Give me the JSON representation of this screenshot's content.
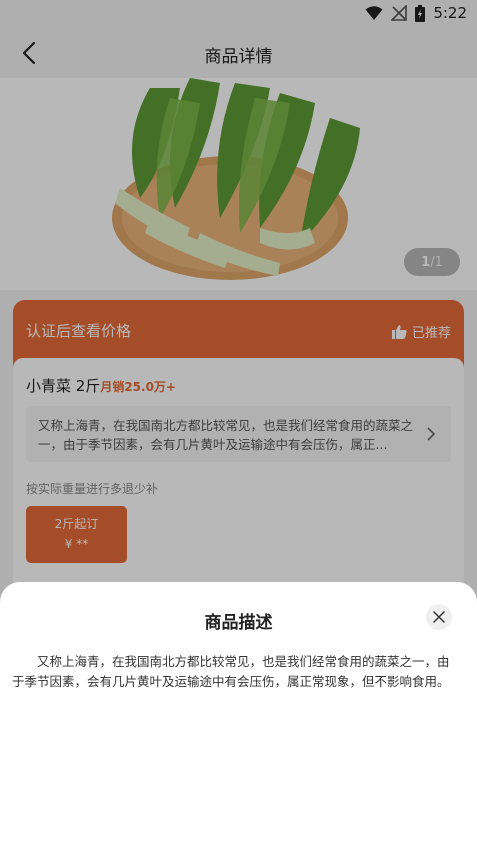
{
  "status_bar": {
    "time": "5:22",
    "icons": [
      "wifi-icon",
      "no-signal-icon",
      "battery-charging-icon"
    ]
  },
  "navbar": {
    "title": "商品详情",
    "back_icon": "chevron-left-icon"
  },
  "gallery": {
    "current": "1",
    "separator": "/",
    "total": "1"
  },
  "price_card": {
    "label": "认证后查看价格",
    "recommend_icon": "thumbs-up-icon",
    "recommend_label": "已推荐"
  },
  "product": {
    "name": "小青菜 2斤",
    "sales": "月销25.0万+",
    "description_preview": "又称上海青，在我国南北方都比较常见，也是我们经常食用的蔬菜之一，由于季节因素，会有几片黄叶及运输途中有会压伤，属正...",
    "weight_note": "按实际重量进行多退少补",
    "spec": {
      "label": "2斤起订",
      "price": "¥ **"
    }
  },
  "sheet": {
    "title": "商品描述",
    "body": "又称上海青，在我国南北方都比较常见，也是我们经常食用的蔬菜之一，由于季节因素，会有几片黄叶及运输途中有会压伤，属正常现象，但不影响食用。",
    "close_icon": "close-icon"
  },
  "colors": {
    "accent": "#e56a39",
    "overlay": "rgba(0,0,0,0.28)"
  }
}
